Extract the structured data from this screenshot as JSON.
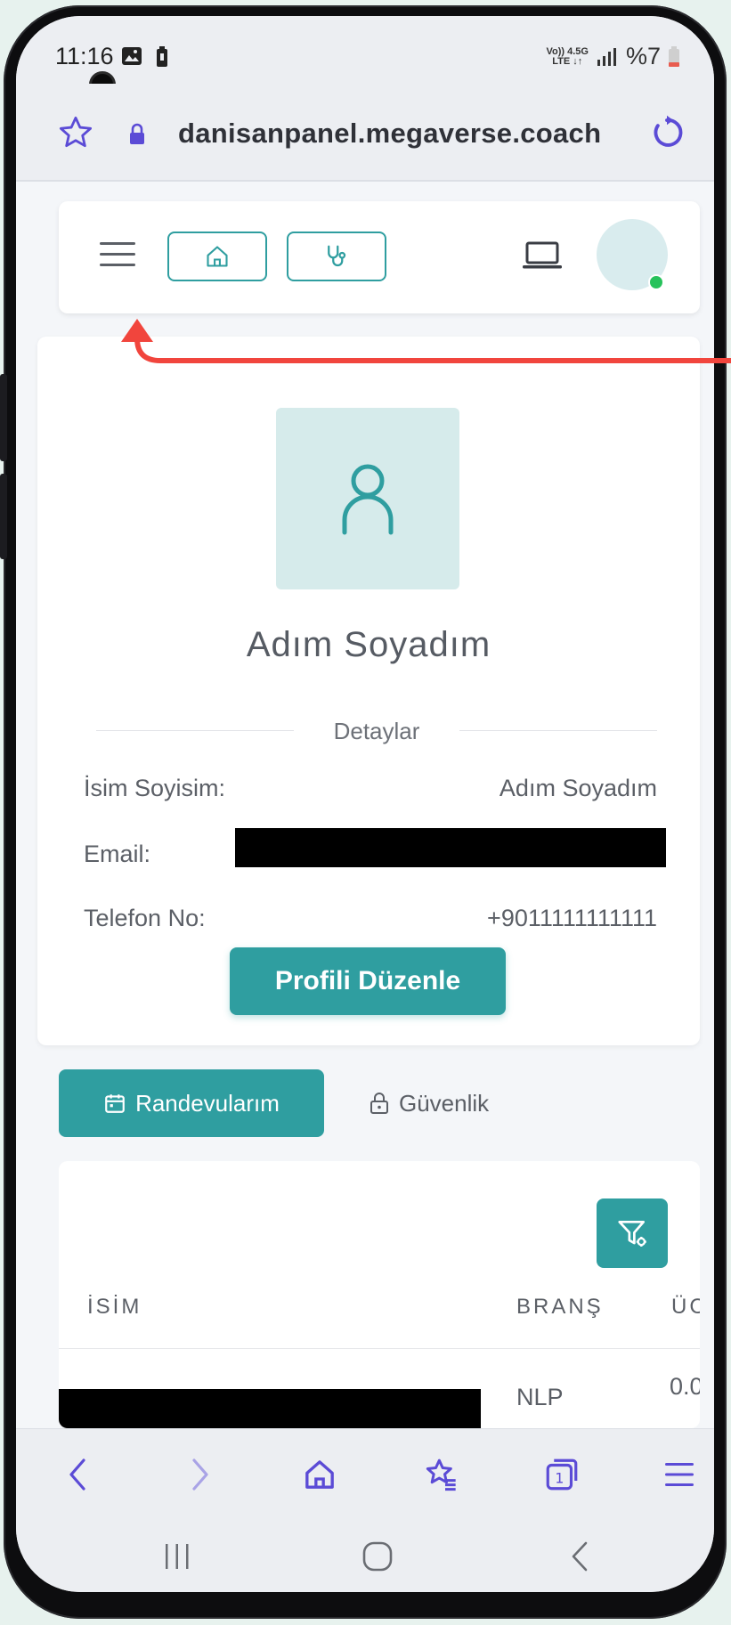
{
  "status": {
    "time": "11:16",
    "network_top": "Vo)) 4.5G",
    "network_bottom": "LTE ↓↑",
    "battery": "%7"
  },
  "browser": {
    "url": "danisanpanel.megaverse.coach",
    "icons": [
      "star-icon",
      "lock-icon",
      "refresh-icon"
    ]
  },
  "topnav": {
    "icons": [
      "hamburger-menu-icon",
      "home-icon",
      "stethoscope-icon",
      "laptop-icon"
    ]
  },
  "profile": {
    "name": "Adım Soyadım",
    "section_title": "Detaylar",
    "details": [
      {
        "label": "İsim Soyisim:",
        "value": "Adım Soyadım"
      },
      {
        "label": "Email:",
        "value": ""
      },
      {
        "label": "Telefon No:",
        "value": "+9011111111111"
      }
    ],
    "edit_button": "Profili Düzenle"
  },
  "tabs": {
    "appointments": "Randevularım",
    "security": "Güvenlik"
  },
  "table": {
    "columns": [
      "İSİM",
      "BRANŞ",
      "ÜC"
    ],
    "rows": [
      {
        "name": "",
        "branch": "NLP",
        "fee": "0.0"
      }
    ]
  },
  "bottom_nav": {
    "icons": [
      "back-arrow-icon",
      "forward-arrow-icon",
      "home-icon",
      "bookmarks-icon",
      "tabs-icon",
      "menu-icon"
    ],
    "tab_count": "1"
  },
  "colors": {
    "accent": "#2f9ea0",
    "browser_purple": "#5b4bd6",
    "annotation_red": "#f1453d"
  }
}
